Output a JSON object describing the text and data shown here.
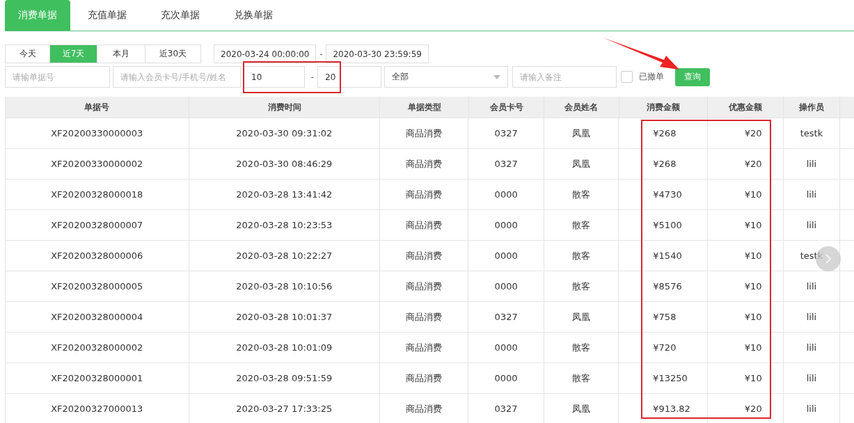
{
  "tabs": [
    {
      "label": "消费单据",
      "selected": true
    },
    {
      "label": "充值单据",
      "selected": false
    },
    {
      "label": "充次单据",
      "selected": false
    },
    {
      "label": "兑换单据",
      "selected": false
    }
  ],
  "ranges": [
    {
      "label": "今天",
      "selected": false
    },
    {
      "label": "近7天",
      "selected": true
    },
    {
      "label": "本月",
      "selected": false
    },
    {
      "label": "近30天",
      "selected": false
    }
  ],
  "date_from": "2020-03-24 00:00:00",
  "date_sep": "-",
  "date_to": "2020-03-30 23:59:59",
  "filters": {
    "order_placeholder": "请输单据号",
    "member_placeholder": "请输入会员卡号/手机号/姓名",
    "amount_min": "10",
    "amount_sep": "-",
    "amount_max": "20",
    "type_value": "全部",
    "note_placeholder": "请输入备注",
    "revoked_label": "已撤单",
    "revoked_checked": false,
    "query_button": "查询"
  },
  "table": {
    "columns": [
      "单据号",
      "消费时间",
      "单据类型",
      "会员卡号",
      "会员姓名",
      "消费金额",
      "优惠金额",
      "操作员"
    ],
    "rows": [
      [
        "XF20200330000003",
        "2020-03-30 09:31:02",
        "商品消费",
        "0327",
        "凤凰",
        "¥268",
        "¥20",
        "testk"
      ],
      [
        "XF20200330000002",
        "2020-03-30 08:46:29",
        "商品消费",
        "0327",
        "凤凰",
        "¥268",
        "¥20",
        "lili"
      ],
      [
        "XF20200328000018",
        "2020-03-28 13:41:42",
        "商品消费",
        "0000",
        "散客",
        "¥4730",
        "¥10",
        "lili"
      ],
      [
        "XF20200328000007",
        "2020-03-28 10:23:53",
        "商品消费",
        "0000",
        "散客",
        "¥5100",
        "¥10",
        "lili"
      ],
      [
        "XF20200328000006",
        "2020-03-28 10:22:27",
        "商品消费",
        "0000",
        "散客",
        "¥1540",
        "¥10",
        "testk"
      ],
      [
        "XF20200328000005",
        "2020-03-28 10:10:56",
        "商品消费",
        "0000",
        "散客",
        "¥8576",
        "¥10",
        "lili"
      ],
      [
        "XF20200328000004",
        "2020-03-28 10:01:37",
        "商品消费",
        "0327",
        "凤凰",
        "¥758",
        "¥10",
        "lili"
      ],
      [
        "XF20200328000002",
        "2020-03-28 10:01:09",
        "商品消费",
        "0000",
        "散客",
        "¥720",
        "¥10",
        "lili"
      ],
      [
        "XF20200328000001",
        "2020-03-28 09:51:59",
        "商品消费",
        "0000",
        "散客",
        "¥13250",
        "¥10",
        "lili"
      ],
      [
        "XF20200327000013",
        "2020-03-27 17:33:25",
        "商品消费",
        "0327",
        "凤凰",
        "¥913.82",
        "¥20",
        "lili"
      ]
    ]
  }
}
